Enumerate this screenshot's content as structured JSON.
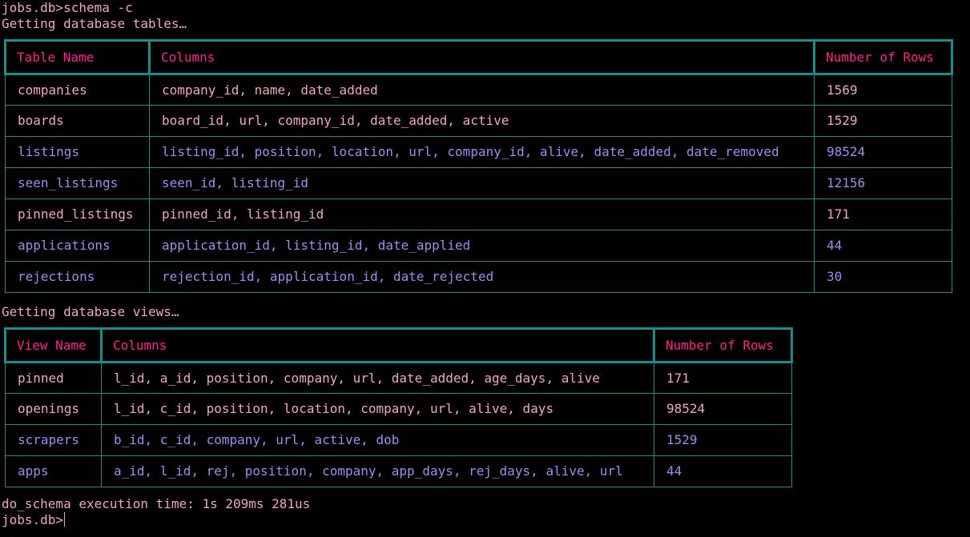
{
  "terminal": {
    "command_line": "jobs.db>schema -c",
    "tables_status": "Getting database tables…",
    "views_status": "Getting database views…",
    "exec_time": "do_schema execution time: 1s 209ms 281us",
    "prompt": "jobs.db>"
  },
  "colors": {
    "background": "#000000",
    "border": "#1a8c8c",
    "header_text": "#ff1f8f",
    "text_pink": "#f2a6b8",
    "text_blue": "#9b8ef0"
  },
  "tables_table": {
    "headers": [
      "Table Name",
      "Columns",
      "Number of Rows"
    ],
    "rows": [
      [
        "companies",
        "company_id, name, date_added",
        "1569"
      ],
      [
        "boards",
        "board_id, url, company_id, date_added, active",
        "1529"
      ],
      [
        "listings",
        "listing_id, position, location, url, company_id, alive, date_added, date_removed",
        "98524"
      ],
      [
        "seen_listings",
        "seen_id, listing_id",
        "12156"
      ],
      [
        "pinned_listings",
        "pinned_id, listing_id",
        "171"
      ],
      [
        "applications",
        "application_id, listing_id, date_applied",
        "44"
      ],
      [
        "rejections",
        "rejection_id, application_id, date_rejected",
        "30"
      ]
    ]
  },
  "views_table": {
    "headers": [
      "View Name",
      "Columns",
      "Number of Rows"
    ],
    "rows": [
      [
        "pinned",
        "l_id, a_id, position, company, url, date_added, age_days, alive",
        "171"
      ],
      [
        "openings",
        "l_id, c_id, position, location, company, url, alive, days",
        "98524"
      ],
      [
        "scrapers",
        "b_id, c_id, company, url, active, dob",
        "1529"
      ],
      [
        "apps",
        "a_id, l_id, rej, position, company, app_days, rej_days, alive, url",
        "44"
      ]
    ]
  }
}
